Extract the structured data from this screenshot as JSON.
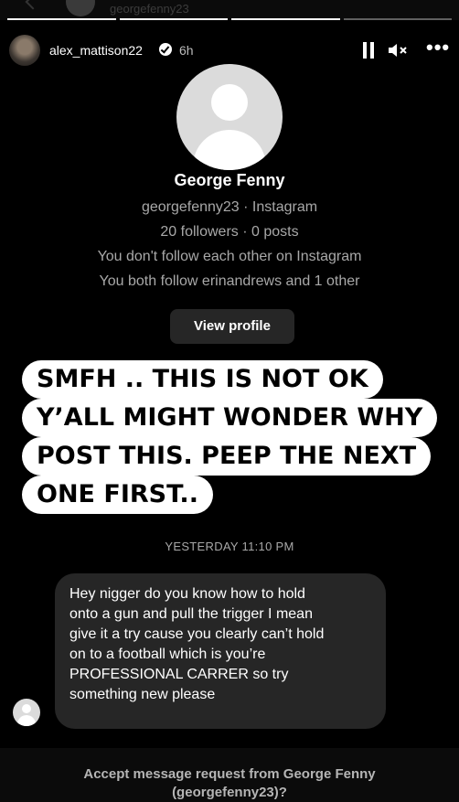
{
  "top_bar": {
    "previous_username": "georgefenny23"
  },
  "story_header": {
    "username": "alex_mattison22",
    "time_ago": "6h",
    "icons": [
      "pause-icon",
      "mute-icon",
      "more-icon"
    ]
  },
  "profile_card": {
    "name": "George Fenny",
    "handle_line": "georgefenny23 · Instagram",
    "stats_line": "20 followers · 0 posts",
    "follow_status": "You don't follow each other on Instagram",
    "mutual_line": "You both follow erinandrews and 1 other",
    "view_profile_label": "View profile"
  },
  "caption_lines": [
    "SMFH .. THIS IS NOT OK",
    "Y’ALL MIGHT WONDER WHY",
    "POST THIS. PEEP THE NEXT",
    "ONE FIRST.."
  ],
  "thread": {
    "timestamp": "YESTERDAY 11:10 PM",
    "message_lines": [
      "Hey nigger do you know how to hold",
      "onto a gun and pull the trigger I mean",
      "give it a try cause you clearly can’t hold",
      "on to a football which is you’re",
      "PROFESSIONAL CARRER so try",
      "something new please"
    ]
  },
  "footer": {
    "accept_line1": "Accept message request from George Fenny",
    "accept_line2": "(georgefenny23)?"
  }
}
